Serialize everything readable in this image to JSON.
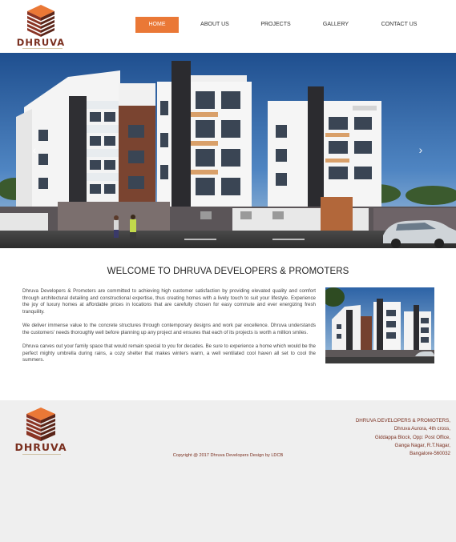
{
  "brand": {
    "name": "DHRUVA",
    "tagline": "DEVELOPERS & PROMOTERS"
  },
  "nav": {
    "items": [
      {
        "label": "HOME",
        "active": true
      },
      {
        "label": "ABOUT US",
        "active": false
      },
      {
        "label": "PROJECTS",
        "active": false
      },
      {
        "label": "GALLERY",
        "active": false
      },
      {
        "label": "CONTACT US",
        "active": false
      }
    ]
  },
  "hero": {
    "prev_icon": "chevron-left-icon",
    "next_icon": "chevron-right-icon",
    "prev_glyph": "‹",
    "next_glyph": "›"
  },
  "welcome": {
    "title": "WELCOME TO DHRUVA DEVELOPERS & PROMOTERS",
    "paragraphs": [
      "Dhruva Developers & Promoters are committed to achieving high customer satisfaction by providing elevated quality and comfort through architectural detailing and constructional expertise, thus creating homes with a lively touch to suit your lifestyle. Experience the joy of luxury homes at affordable prices in locations that are carefully chosen for easy commute and ever energizing fresh tranquility.",
      "We deliver immense value to the concrete structures through contemporary designs and work par excellence. Dhruva understands the customers' needs thoroughly well before planning up any project and ensures that each of its projects is worth a million smiles.",
      "Dhruva carves out your family space that would remain special to you for decades. Be sure to experience a home which would be the perfect mighty umbrella during rains, a cozy shelter that makes winters warm, a well ventilated cool haven all set to cool the summers."
    ]
  },
  "footer": {
    "copyright": "Copyright @ 2017 Dhruva Developers Design by LDCB",
    "address": [
      "DHRUVA DEVELOPERS & PROMOTERS,",
      "Dhruva Aurora, 4th cross,",
      "Giddappa Block, Opp: Post Office,",
      "Ganga Nagar, R.T.Nagar,",
      "Bangalore-560032"
    ]
  },
  "colors": {
    "accent": "#ea7836",
    "brand_brown": "#7a2f1f",
    "footer_bg": "#efefef"
  }
}
